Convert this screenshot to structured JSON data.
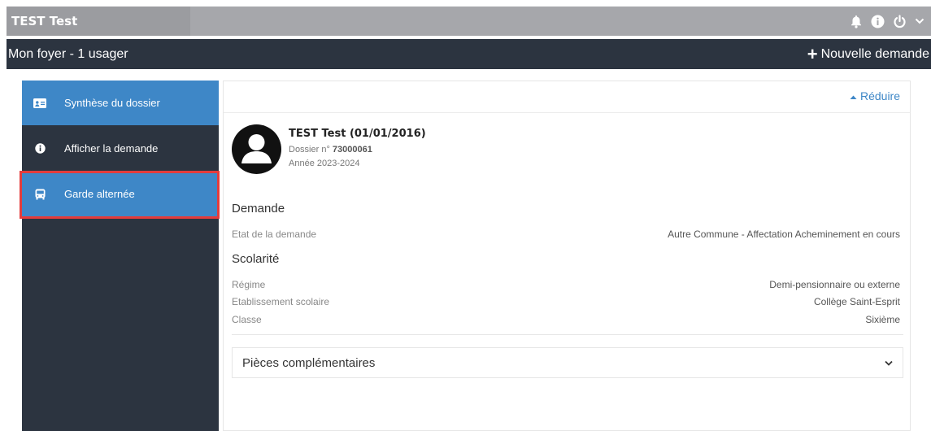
{
  "topbar": {
    "brand": "TEST Test",
    "icons": [
      "bell-icon",
      "info-icon",
      "power-icon",
      "chevron-down-icon"
    ]
  },
  "subbar": {
    "title": "Mon foyer - 1 usager",
    "new_request_label": "Nouvelle demande"
  },
  "sidebar": {
    "items": [
      {
        "label": "Synthèse du dossier",
        "icon": "id-card-icon"
      },
      {
        "label": "Afficher la demande",
        "icon": "info-icon"
      },
      {
        "label": "Garde alternée",
        "icon": "bus-icon"
      }
    ]
  },
  "panel": {
    "reduce_label": "Réduire",
    "person": {
      "name": "TEST Test (01/01/2016)",
      "dossier_prefix": "Dossier n°",
      "dossier_number": "73000061",
      "annee": "Année 2023-2024"
    },
    "demande": {
      "title": "Demande",
      "etat_label": "Etat de la demande",
      "etat_value": "Autre Commune - Affectation Acheminement en cours"
    },
    "scolarite": {
      "title": "Scolarité",
      "regime_label": "Régime",
      "regime_value": "Demi-pensionnaire ou externe",
      "etablissement_label": "Etablissement scolaire",
      "etablissement_value": "Collège Saint-Esprit",
      "classe_label": "Classe",
      "classe_value": "Sixième"
    },
    "pieces_label": "Pièces complémentaires"
  },
  "colors": {
    "accent": "#3e87c7",
    "dark": "#2c3440",
    "topbar": "#a6a7ab",
    "highlight_border": "#e33c3c"
  }
}
